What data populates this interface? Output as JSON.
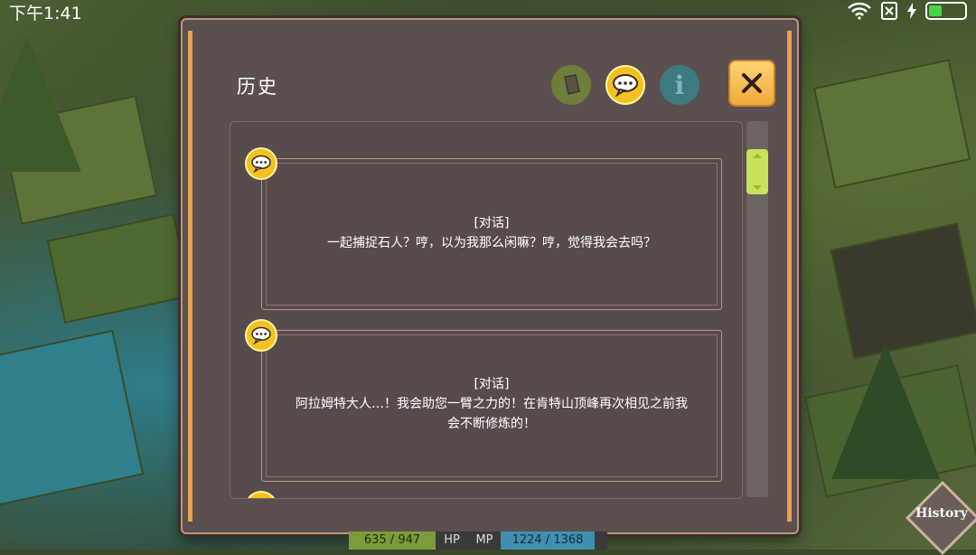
{
  "status_bar": {
    "time": "下午1:41"
  },
  "panel": {
    "title": "历史",
    "tabs": [
      {
        "icon": "quest-scroll-icon"
      },
      {
        "icon": "speech-bubble-icon",
        "selected": true
      },
      {
        "icon": "info-icon",
        "label": "i"
      }
    ],
    "close_icon": "close-icon"
  },
  "entries": [
    {
      "tag": "[对话]",
      "lines": [
        "一起捕捉石人？哼，以为我那么闲嘛？哼，觉得我会去吗？"
      ]
    },
    {
      "tag": "[对话]",
      "lines": [
        "阿拉姆特大人…！我会助您一臂之力的！在肯特山顶峰再次相见之前我",
        "会不断修炼的！"
      ]
    }
  ],
  "stats": {
    "hp": "635 / 947",
    "hp_label": "HP",
    "mp_label": "MP",
    "mp": "1224 / 1368"
  },
  "history_button": "History",
  "colors": {
    "accent": "#f3c21f",
    "panel": "#5c4f50",
    "scroll": "#c6e25a"
  }
}
